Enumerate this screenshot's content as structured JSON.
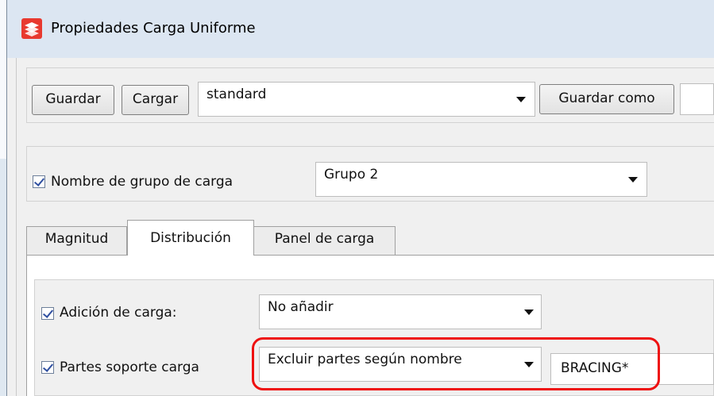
{
  "window": {
    "title": "Propiedades Carga Uniforme",
    "icon": "tekla-app-icon"
  },
  "toolbar": {
    "save_label": "Guardar",
    "load_label": "Cargar",
    "preset_value": "standard",
    "save_as_label": "Guardar como",
    "save_as_value": ""
  },
  "load_group": {
    "checkbox_checked": true,
    "label": "Nombre de grupo de carga",
    "value": "Grupo 2"
  },
  "tabs": [
    {
      "label": "Magnitud",
      "active": false
    },
    {
      "label": "Distribución",
      "active": true
    },
    {
      "label": "Panel de carga",
      "active": false
    }
  ],
  "distribution": {
    "load_addition": {
      "checked": true,
      "label": "Adición de carga:",
      "value": "No añadir"
    },
    "supporting_parts": {
      "checked": true,
      "label": "Partes soporte carga",
      "value": "Excluir partes según nombre",
      "filter": "BRACING*"
    }
  },
  "colors": {
    "highlight": "#ee1111",
    "titlebar": "#dce6f2",
    "panel": "#f0f0f0"
  }
}
